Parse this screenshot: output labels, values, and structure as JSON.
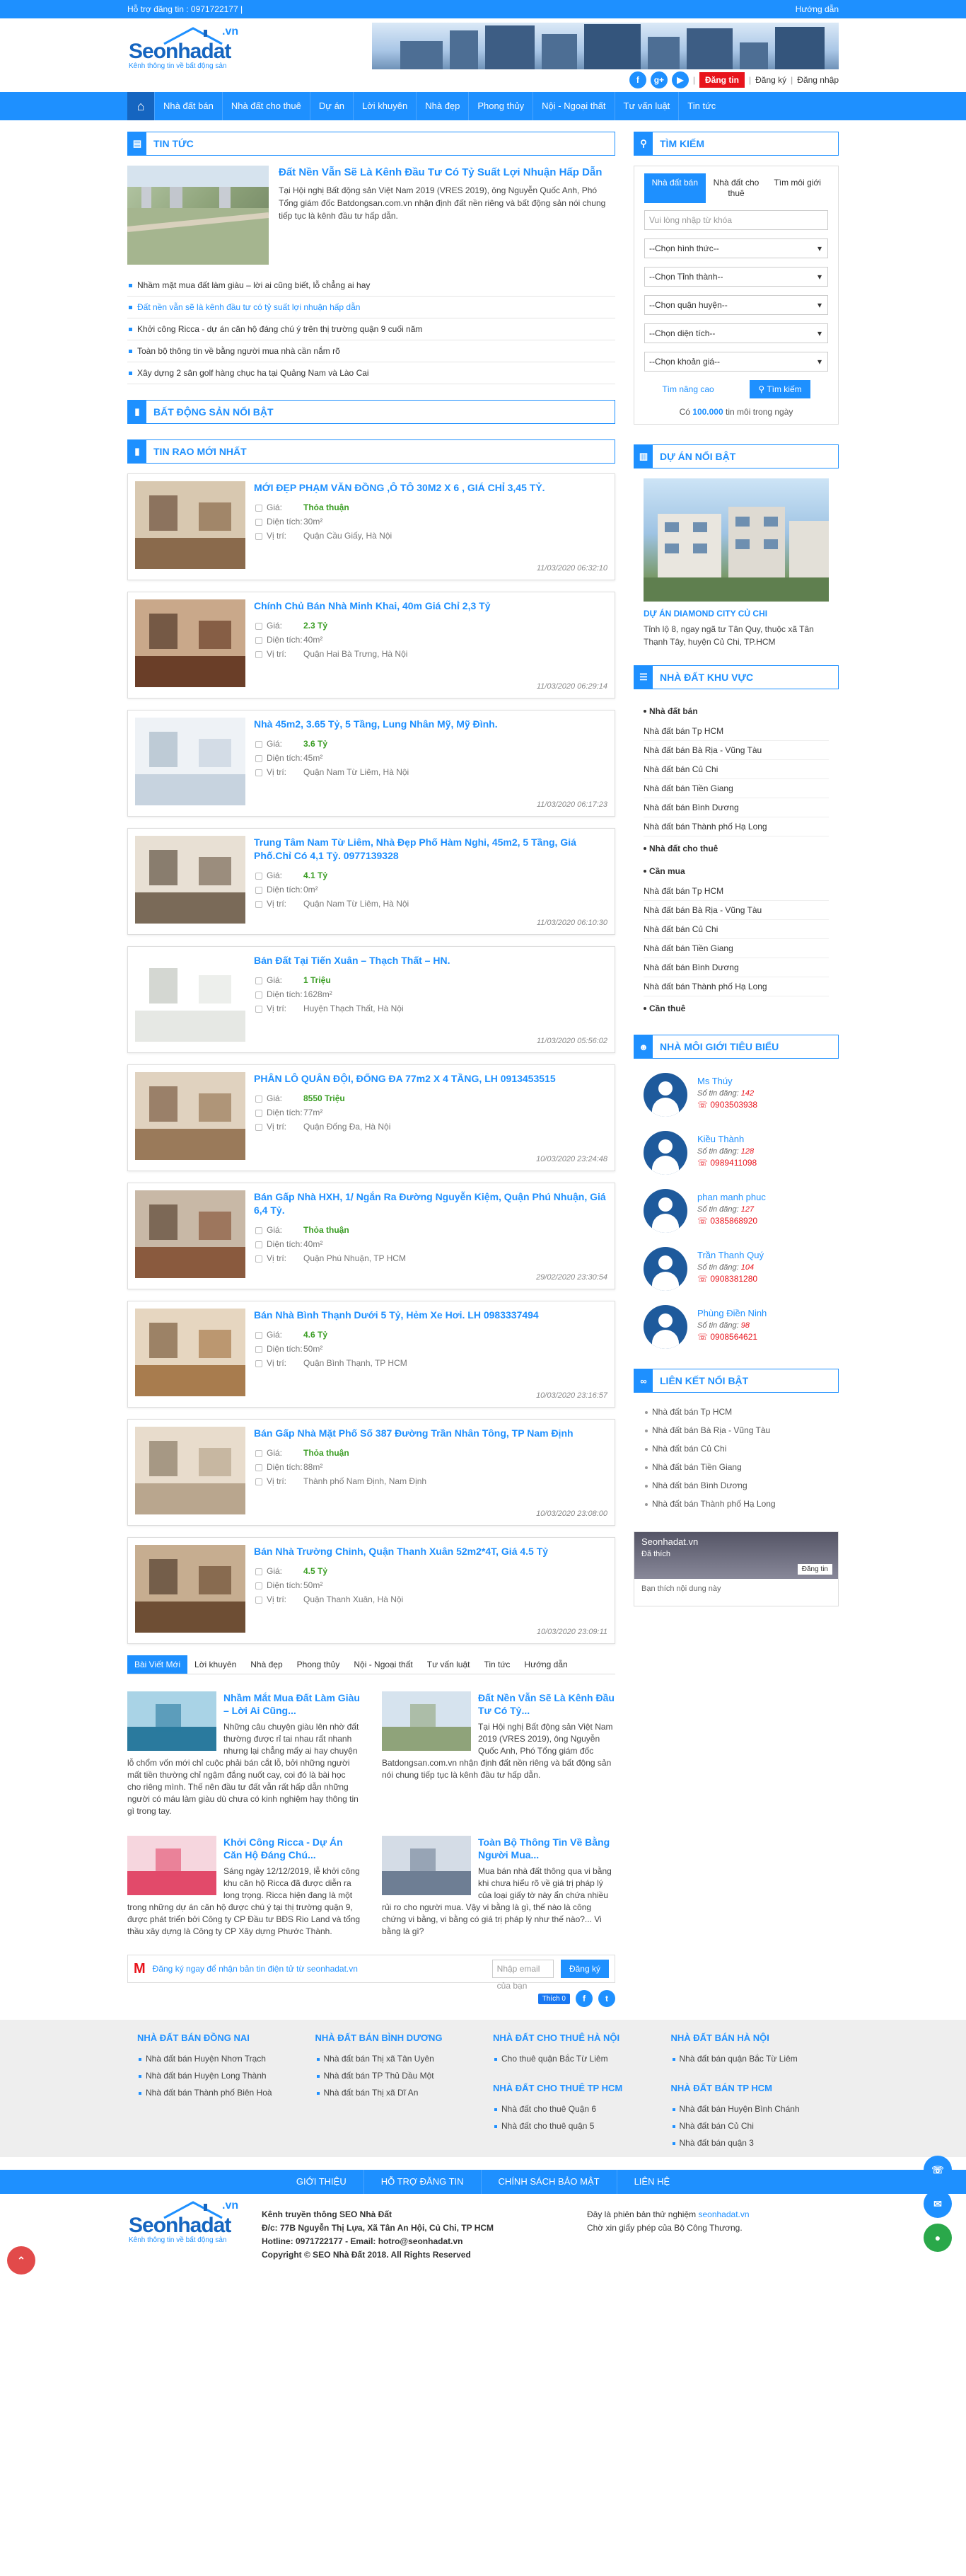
{
  "topbar": {
    "support": "Hỗ trợ đăng tin : 0971722177  |",
    "guide": "Hướng dẫn"
  },
  "logo": {
    "brand": "Seonhadat",
    "tld": ".vn",
    "slogan": "Kênh thông tin về bất động sản"
  },
  "header": {
    "social": [
      "f",
      "g+",
      "▶"
    ],
    "post": "Đăng tin",
    "register": "Đăng ký",
    "login": "Đăng nhập",
    "sep": "|"
  },
  "nav": [
    "Nhà đất bán",
    "Nhà đất cho thuê",
    "Dự án",
    "Lời khuyên",
    "Nhà đẹp",
    "Phong thủy",
    "Nội - Ngoại thất",
    "Tư vấn luật",
    "Tin tức"
  ],
  "news": {
    "title": "TIN TỨC",
    "feature_title": "Đất Nền Vẫn Sẽ Là Kênh Đầu Tư Có Tỷ Suất Lợi Nhuận Hấp Dẫn",
    "feature_desc": "Tại Hội nghị Bất động sản Việt Nam 2019 (VRES 2019), ông Nguyễn Quốc Anh, Phó Tổng giám đốc Batdongsan.com.vn nhận định đất nền riêng và bất động sản nói chung tiếp tục là kênh đầu tư hấp dẫn.",
    "items": [
      "Nhầm mặt mua đất làm giàu – lời ai cũng biết, lỗ chẳng ai hay",
      "Đất nền vẫn sẽ là kênh đầu tư có tỷ suất lợi nhuận hấp dẫn",
      "Khởi công Ricca - dự án căn hộ đáng chú ý trên thị trường quận 9 cuối năm",
      "Toàn bộ thông tin về bằng người mua nhà cần nắm rõ",
      "Xây dựng 2 sân golf hàng chục ha tại Quảng Nam và Lào Cai"
    ]
  },
  "featured_title": "BẤT ĐỘNG SẢN NỔI BẬT",
  "latest": {
    "title": "TIN RAO MỚI NHẤT",
    "labels": {
      "price": "Giá:",
      "area": "Diện tích:",
      "loc": "Vị trí:"
    },
    "items": [
      {
        "title": "MỚI ĐẸP PHẠM VĂN ĐỒNG ,Ô TÔ 30M2 X 6 , GIÁ CHỈ 3,45 TỶ.",
        "price": "Thỏa thuận",
        "area": "30m²",
        "loc": "Quận Cầu Giấy, Hà Nội",
        "date": "11/03/2020 06:32:10"
      },
      {
        "title": "Chính Chủ Bán Nhà Minh Khai, 40m Giá Chỉ 2,3 Tỷ",
        "price": "2.3 Tỷ",
        "area": "40m²",
        "loc": "Quận Hai Bà Trưng, Hà Nội",
        "date": "11/03/2020 06:29:14"
      },
      {
        "title": "Nhà 45m2, 3.65 Tỷ, 5 Tầng, Lung Nhân Mỹ, Mỹ Đình.",
        "price": "3.6 Tỷ",
        "area": "45m²",
        "loc": "Quận Nam Từ Liêm, Hà Nội",
        "date": "11/03/2020 06:17:23"
      },
      {
        "title": "Trung Tâm Nam Từ Liêm, Nhà Đẹp Phố Hàm Nghi, 45m2, 5 Tầng, Giá Phố.Chỉ Có 4,1 Tỷ. 0977139328",
        "price": "4.1 Tỷ",
        "area": "0m²",
        "loc": "Quận Nam Từ Liêm, Hà Nội",
        "date": "11/03/2020 06:10:30"
      },
      {
        "title": "Bán Đất Tại Tiến Xuân – Thạch Thất – HN.",
        "price": "1 Triệu",
        "area": "1628m²",
        "loc": "Huyện Thạch Thất, Hà Nội",
        "date": "11/03/2020 05:56:02"
      },
      {
        "title": "PHÂN LÔ QUÂN ĐỘI, ĐỐNG ĐA 77m2 X 4 TẦNG, LH 0913453515",
        "price": "8550 Triệu",
        "area": "77m²",
        "loc": "Quận Đống Đa, Hà Nội",
        "date": "10/03/2020 23:24:48"
      },
      {
        "title": "Bán Gấp Nhà HXH, 1/ Ngắn Ra Đường Nguyễn Kiệm, Quận Phú Nhuận, Giá 6,4 Tỷ.",
        "price": "Thỏa thuận",
        "area": "40m²",
        "loc": "Quận Phú Nhuận, TP HCM",
        "date": "29/02/2020 23:30:54"
      },
      {
        "title": "Bán Nhà Bình Thạnh Dưới 5 Tỷ, Hẻm Xe Hơi. LH 0983337494",
        "price": "4.6 Tỷ",
        "area": "50m²",
        "loc": "Quận Bình Thạnh, TP HCM",
        "date": "10/03/2020 23:16:57"
      },
      {
        "title": "Bán Gấp Nhà Mặt Phố Số 387 Đường Trần Nhân Tông, TP Nam Định",
        "price": "Thỏa thuận",
        "area": "88m²",
        "loc": "Thành phố Nam Định, Nam Định",
        "date": "10/03/2020 23:08:00"
      },
      {
        "title": "Bán Nhà Trường Chinh, Quận Thanh Xuân 52m2*4T, Giá 4.5 Tỷ",
        "price": "4.5 Tỷ",
        "area": "50m²",
        "loc": "Quận Thanh Xuân, Hà Nội",
        "date": "10/03/2020 23:09:11"
      }
    ]
  },
  "tabs": [
    "Bài Viết Mới",
    "Lời khuyên",
    "Nhà đẹp",
    "Phong thủy",
    "Nội - Ngoại thất",
    "Tư vấn luật",
    "Tin tức",
    "Hướng dẫn"
  ],
  "articles": [
    {
      "title": "Nhầm Mắt Mua Đất Làm Giàu – Lời Ai Cũng...",
      "desc": "Những câu chuyện giàu lên nhờ đất thường được rỉ tai nhau rất nhanh nhưng lại chẳng mấy ai hay chuyện lỗ chổm vốn mới chỉ cuộc phải bán cắt lỗ, bởi những người mất tiền thường chỉ ngậm đắng nuốt cay, coi đó là bài học cho riêng mình. Thế nên đầu tư đất vẫn rất hấp dẫn những người có máu làm giàu dù chưa có kinh nghiệm hay thông tin gì trong tay."
    },
    {
      "title": "Đất Nền Vẫn Sẽ Là Kênh Đầu Tư Có Tỷ...",
      "desc": "Tại Hội nghị Bất động sản Việt Nam 2019 (VRES 2019), ông Nguyễn Quốc Anh, Phó Tổng giám đốc Batdongsan.com.vn nhận định đất nền riêng và bất động sản nói chung tiếp tục là kênh đầu tư hấp dẫn."
    },
    {
      "title": "Khởi Công Ricca - Dự Án Căn Hộ Đáng Chú...",
      "desc": "Sáng ngày 12/12/2019, lễ khởi công khu căn hộ Ricca đã được diễn ra long trọng. Ricca hiện đang là một trong những dự án căn hộ được chú ý tại thị trường quận 9, được phát triển bởi Công ty CP Đầu tư BĐS Rio Land và tổng thầu xây dựng là Công ty CP Xây dựng Phước Thành."
    },
    {
      "title": "Toàn Bộ Thông Tin Về Bằng Người Mua...",
      "desc": "Mua bán nhà đất thông qua vi bằng khi chưa hiểu rõ về giá trị pháp lý của loại giấy tờ này ẩn chứa nhiều rủi ro cho người mua. Vậy vi bằng là gì, thế nào là công chứng vi bằng, vi bằng có giá trị pháp lý như thế nào?... Vi bằng là gì?"
    }
  ],
  "subscribe": {
    "text": "Đăng ký ngay để nhận bản tin điện tử từ seonhadat.vn",
    "placeholder": "Nhập email của bạn",
    "button": "Đăng ký"
  },
  "share": {
    "like": "Thích 0"
  },
  "search": {
    "title": "TÌM KIẾM",
    "tabs": [
      "Nhà đất bán",
      "Nhà đất cho thuê",
      "Tìm môi giới"
    ],
    "placeholder": "Vui lòng nhập từ khóa",
    "selects": [
      "--Chọn hình thức--",
      "--Chọn Tỉnh thành--",
      "--Chọn quận huyện--",
      "--Chọn diện tích--",
      "--Chọn khoản giá--"
    ],
    "advanced": "Tìm nâng cao",
    "button": "Tìm kiếm",
    "count_pre": "Có",
    "count": "100.000",
    "count_post": "tin môi trong ngày"
  },
  "project": {
    "title": "DỰ ÁN NỔI BẬT",
    "name": "DỰ ÁN DIAMOND CITY CỦ CHI",
    "desc": "Tỉnh lộ 8, ngay ngã tư Tân Quy, thuộc xã Tân Thạnh Tây, huyện Củ Chi, TP.HCM"
  },
  "region": {
    "title": "NHÀ ĐẤT KHU VỰC",
    "groups": [
      {
        "name": "Nhà đất bán",
        "items": [
          "Nhà đất bán Tp HCM",
          "Nhà đất bán Bà Rịa - Vũng Tàu",
          "Nhà đất bán Củ Chi",
          "Nhà đất bán Tiền Giang",
          "Nhà đất bán Bình Dương",
          "Nhà đất bán Thành phố Hạ Long"
        ]
      },
      {
        "name": "Nhà đất cho thuê",
        "items": []
      },
      {
        "name": "Cần mua",
        "items": [
          "Nhà đất bán Tp HCM",
          "Nhà đất bán Bà Rịa - Vũng Tàu",
          "Nhà đất bán Củ Chi",
          "Nhà đất bán Tiền Giang",
          "Nhà đất bán Bình Dương",
          "Nhà đất bán Thành phố Hạ Long"
        ]
      },
      {
        "name": "Cần thuê",
        "items": []
      }
    ]
  },
  "brokers": {
    "title": "NHÀ MÔI GIỚI TIÊU BIỂU",
    "label": "Số tin đăng:",
    "items": [
      {
        "name": "Ms Thúy",
        "count": "142",
        "phone": "0903503938"
      },
      {
        "name": "Kiều Thành",
        "count": "128",
        "phone": "0989411098"
      },
      {
        "name": "phan manh phuc",
        "count": "127",
        "phone": "0385868920"
      },
      {
        "name": "Trần Thanh Quý",
        "count": "104",
        "phone": "0908381280"
      },
      {
        "name": "Phùng Điền Ninh",
        "count": "98",
        "phone": "0908564621"
      }
    ]
  },
  "links": {
    "title": "LIÊN KẾT NỔI BẬT",
    "items": [
      "Nhà đất bán Tp HCM",
      "Nhà đất bán Bà Rịa - Vũng Tàu",
      "Nhà đất bán Củ Chi",
      "Nhà đất bán Tiền Giang",
      "Nhà đất bán Bình Dương",
      "Nhà đất bán Thành phố Hạ Long"
    ]
  },
  "fb": {
    "name": "Seonhadat.vn",
    "liked": "Đã thích",
    "button": "Đăng tin",
    "friends": "Bạn thích nội dung này"
  },
  "footer": {
    "cols": [
      {
        "h1": "NHÀ ĐẤT BÁN ĐỒNG NAI",
        "i1": [
          "Nhà đất bán Huyện Nhơn Trạch",
          "Nhà đất bán Huyện Long Thành",
          "Nhà đất bán Thành phố Biên Hoà"
        ],
        "h2": "",
        "i2": []
      },
      {
        "h1": "NHÀ ĐẤT BÁN BÌNH DƯƠNG",
        "i1": [
          "Nhà đất bán Thị xã Tân Uyên",
          "Nhà đất bán TP Thủ Dầu Một",
          "Nhà đất bán Thị xã Dĩ An"
        ],
        "h2": "",
        "i2": []
      },
      {
        "h1": "NHÀ ĐẤT CHO THUÊ HÀ NỘI",
        "i1": [
          "Cho thuê quận Bắc Từ Liêm"
        ],
        "h2": "NHÀ ĐẤT CHO THUÊ TP HCM",
        "i2": [
          "Nhà đất cho thuê Quận 6",
          "Nhà đất cho thuê quận 5"
        ]
      },
      {
        "h1": "NHÀ ĐẤT BÁN HÀ NỘI",
        "i1": [
          "Nhà đất bán quận Bắc Từ Liêm"
        ],
        "h2": "NHÀ ĐẤT BÁN TP HCM",
        "i2": [
          "Nhà đất bán Huyện Bình Chánh",
          "Nhà đất bán Củ Chi",
          "Nhà đất bán quận 3"
        ]
      }
    ],
    "nav": [
      "GIỚI THIỆU",
      "HỖ TRỢ ĐĂNG TIN",
      "CHÍNH SÁCH BẢO MẬT",
      "LIÊN HỆ"
    ],
    "company": "Kênh truyền thông SEO Nhà Đất",
    "address": "Đ/c: 77B Nguyễn Thị Lựa, Xã Tân An Hội, Củ Chi, TP HCM",
    "hotline": "Hotline: 0971722177 - Email: hotro@seonhadat.vn",
    "copyright": "Copyright © SEO Nhà Đất 2018. All Rights Reserved",
    "note_pre": "Đây là phiên bản thử nghiệm",
    "note_link": "seonhadat.vn",
    "note2": "Chờ xin giấy phép của Bộ Công Thương."
  },
  "colors": {
    "primary": "#1e90ff",
    "accent": "#e8141c",
    "price": "#3a9d23"
  }
}
